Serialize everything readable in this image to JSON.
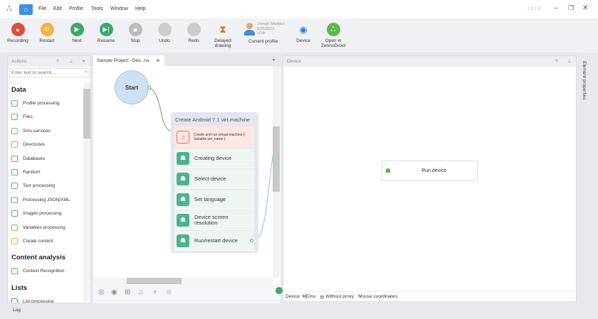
{
  "app": {
    "version": "2.3.1.0",
    "menu": [
      "File",
      "Edit",
      "Profile",
      "Tools",
      "Window",
      "Help"
    ]
  },
  "toolbar": [
    {
      "label": "Recording",
      "color": "#e04b3c",
      "glyph": "●"
    },
    {
      "label": "Restart",
      "color": "#f0b43c",
      "glyph": "↻"
    },
    {
      "label": "Next",
      "color": "#3aaa6b",
      "glyph": "▶"
    },
    {
      "label": "Resume",
      "color": "#3aaa6b",
      "glyph": "⏭"
    },
    {
      "label": "Stop",
      "color": "#bbbbbb",
      "glyph": "■"
    },
    {
      "label": "Undo",
      "color": "#cccccc",
      "glyph": ""
    },
    {
      "label": "Redo",
      "color": "#cccccc",
      "glyph": ""
    }
  ],
  "delayed": {
    "line1": "Delayed",
    "line2": "drawing"
  },
  "profile": {
    "name": "Joseph Maddox",
    "date": "3/25/2002",
    "country": "USA",
    "label": "Current profile"
  },
  "device_btn": "Device",
  "zenno": {
    "line1": "Open in",
    "line2": "ZennoDroid"
  },
  "actions": {
    "title": "Actions",
    "search_placeholder": "Enter text to search...",
    "sections": [
      {
        "title": "Data",
        "items": [
          "Profile processing",
          "Files",
          "Sms-services",
          "Directories",
          "Databases",
          "Random",
          "Text processing",
          "Processing JSON/XML",
          "Images processing",
          "Variables processing",
          "Create content"
        ]
      },
      {
        "title": "Content analysis",
        "items": [
          "Context Recognition"
        ]
      },
      {
        "title": "Lists",
        "items": [
          "List processing"
        ]
      }
    ]
  },
  "project": {
    "tab": "Sample Project - Dev...ns",
    "start": "Start",
    "node": {
      "title": "Create Android 7.1 virt.machine",
      "first": "Create and run virtual machine {-Variable.vm_name-}",
      "rows": [
        "Creating device",
        "Select device",
        "Set language",
        "Device screen resolution",
        "Run/restart device"
      ]
    }
  },
  "device": {
    "title": "Device",
    "run": "Run device",
    "status": {
      "device": "Device: MEmu",
      "proxy": "Without proxy",
      "mouse": "Mouse coordinates:"
    }
  },
  "right_sidebar": "Element properties",
  "log": "Log"
}
